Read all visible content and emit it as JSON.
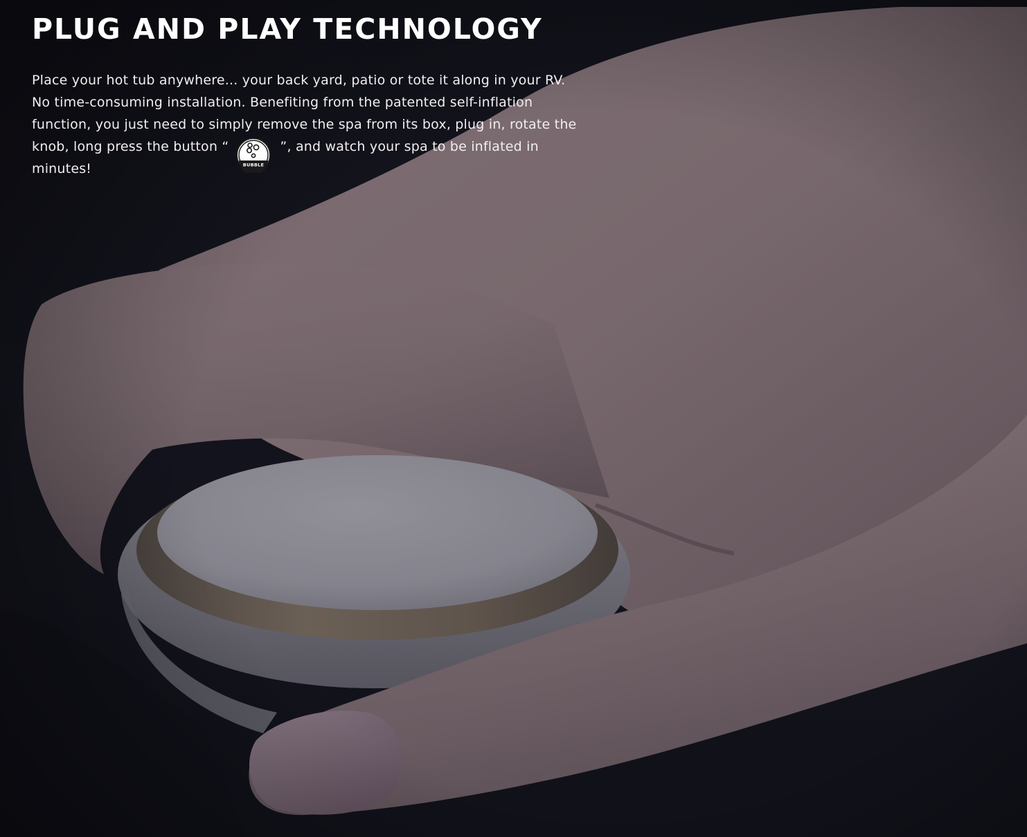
{
  "heading": "PLUG AND PLAY TECHNOLOGY",
  "paragraph": {
    "before_icon": "Place your hot tub anywhere... your back yard, patio or tote it along in your RV. No time-consuming installation. Benefiting from the patented self-inflation function, you just need to simply remove the spa from its box, plug in, rotate the knob, long press the button “",
    "after_icon": "”,  and watch your spa to be inflated in minutes!"
  },
  "button_icon": {
    "name": "bubble-button-icon",
    "label": "BUBBLE"
  },
  "colors": {
    "background": "#14141c",
    "text": "#ffffff",
    "skin": "#b89e9e",
    "knob_rim": "#8f7e6a",
    "knob_face": "#cfcdd6"
  }
}
